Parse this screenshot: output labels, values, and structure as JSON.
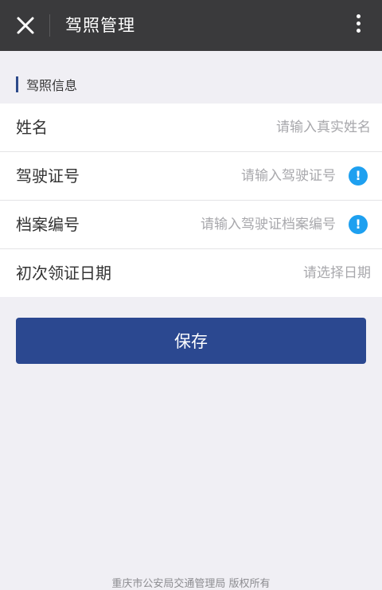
{
  "header": {
    "title": "驾照管理",
    "close_icon": "close-icon",
    "more_icon": "more-vertical-icon"
  },
  "section": {
    "title": "驾照信息",
    "accent_color": "#2d4a8a"
  },
  "form": {
    "rows": [
      {
        "label": "姓名",
        "value": "",
        "placeholder": "请输入真实姓名",
        "has_info": false
      },
      {
        "label": "驾驶证号",
        "value": "",
        "placeholder": "请输入驾驶证号",
        "has_info": true
      },
      {
        "label": "档案编号",
        "value": "",
        "placeholder": "请输入驾驶证档案编号",
        "has_info": true
      },
      {
        "label": "初次领证日期",
        "value": "",
        "placeholder": "请选择日期",
        "has_info": false
      }
    ],
    "info_icon": "info-icon",
    "info_glyph": "!",
    "info_color": "#1ea0f0"
  },
  "actions": {
    "save_label": "保存",
    "save_color": "#2b4890"
  },
  "footer": {
    "text": "重庆市公安局交通管理局 版权所有"
  }
}
